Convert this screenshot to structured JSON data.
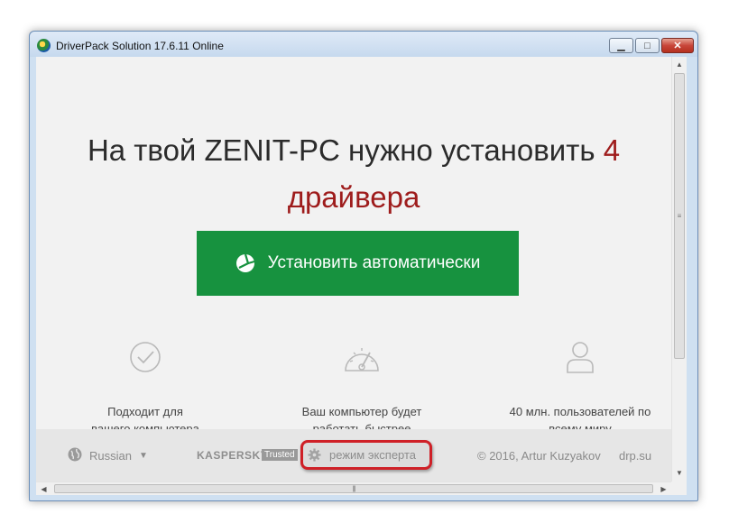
{
  "window": {
    "title": "DriverPack Solution 17.6.11 Online",
    "buttons": {
      "minimize": "▭",
      "maximize": "□",
      "close": "✕"
    }
  },
  "headline": {
    "main": "На твой ZENIT-PC нужно установить ",
    "count": "4",
    "unit": "драйвера"
  },
  "install_button": {
    "label": "Установить автоматически",
    "icon": "driverpack-logo-icon"
  },
  "features": [
    {
      "icon": "checkmark-circle-icon",
      "line1": "Подходит для",
      "line2": "вашего компьютера"
    },
    {
      "icon": "speedometer-icon",
      "line1": "Ваш компьютер будет",
      "line2": "работать быстрее"
    },
    {
      "icon": "user-icon",
      "line1": "40 млн. пользователей по",
      "line2": "всему миру"
    }
  ],
  "footer": {
    "language": "Russian",
    "kaspersky": "KASPERSKY",
    "trusted": "Trusted",
    "expert_mode": "режим эксперта",
    "copyright": "© 2016, Artur Kuzyakov",
    "site": "drp.su"
  },
  "colors": {
    "accent_green": "#17923f",
    "accent_red": "#9e1c1c",
    "highlight_border": "#cf2027"
  }
}
